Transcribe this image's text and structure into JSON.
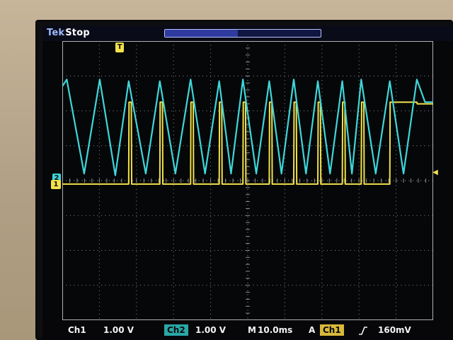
{
  "header": {
    "brand": "Tek",
    "run_state": "Stop",
    "record_view_fraction": 0.47
  },
  "markers": {
    "trigger_position": "T",
    "ch2_ground": "2",
    "ch1_ground": "1"
  },
  "status": {
    "ch1_label": "Ch1",
    "ch1_scale": "1.00 V",
    "ch2_label": "Ch2",
    "ch2_scale": "1.00 V",
    "time_prefix": "M",
    "timebase": "10.0ms",
    "trigger_prefix": "A",
    "trigger_source": "Ch1",
    "trigger_slope_icon": "rising-edge-icon",
    "trigger_level": "160mV"
  },
  "colors": {
    "ch1": "#f2e14a",
    "ch2": "#3fd6d9",
    "grid": "#8a8a8a"
  },
  "chart_data": {
    "type": "line",
    "x_unit": "div",
    "xlim": [
      0,
      10
    ],
    "ylim": [
      -4,
      4
    ],
    "grid": true,
    "series": [
      {
        "name": "Ch1",
        "x": [
          0.0,
          1.79,
          1.8,
          1.86,
          1.87,
          2.63,
          2.64,
          2.7,
          2.71,
          3.46,
          3.47,
          3.53,
          3.54,
          4.23,
          4.24,
          4.3,
          4.31,
          4.87,
          4.88,
          4.94,
          4.95,
          5.58,
          5.59,
          5.65,
          5.66,
          6.24,
          6.25,
          6.31,
          6.32,
          6.89,
          6.9,
          6.96,
          6.97,
          7.55,
          7.56,
          7.62,
          7.63,
          8.06,
          8.07,
          8.13,
          8.14,
          8.83,
          8.84,
          9.56,
          9.57,
          10.0
        ],
        "y": [
          -0.1,
          -0.1,
          2.25,
          2.25,
          -0.1,
          -0.1,
          2.25,
          2.25,
          -0.1,
          -0.1,
          2.25,
          2.25,
          -0.1,
          -0.1,
          2.25,
          2.25,
          -0.1,
          -0.1,
          2.25,
          2.25,
          -0.1,
          -0.1,
          2.25,
          2.25,
          -0.1,
          -0.1,
          2.25,
          2.25,
          -0.1,
          -0.1,
          2.25,
          2.25,
          -0.1,
          -0.1,
          2.25,
          2.25,
          -0.1,
          -0.1,
          2.25,
          2.25,
          -0.1,
          -0.1,
          2.25,
          2.25,
          2.2,
          2.2
        ]
      },
      {
        "name": "Ch2",
        "x": [
          0.0,
          0.12,
          0.59,
          1.01,
          1.43,
          1.79,
          2.25,
          2.63,
          3.05,
          3.46,
          3.85,
          4.23,
          4.55,
          4.87,
          5.23,
          5.58,
          5.91,
          6.24,
          6.57,
          6.89,
          7.22,
          7.55,
          7.81,
          8.06,
          8.45,
          8.83,
          9.2,
          9.56,
          9.78,
          10.0
        ],
        "y": [
          2.7,
          2.9,
          0.2,
          2.9,
          0.15,
          2.85,
          0.2,
          2.85,
          0.2,
          2.9,
          0.2,
          2.85,
          0.2,
          2.9,
          0.2,
          2.85,
          0.2,
          2.9,
          0.2,
          2.85,
          0.2,
          2.85,
          0.2,
          2.9,
          0.2,
          2.85,
          0.2,
          2.9,
          2.25,
          2.25
        ]
      }
    ]
  }
}
